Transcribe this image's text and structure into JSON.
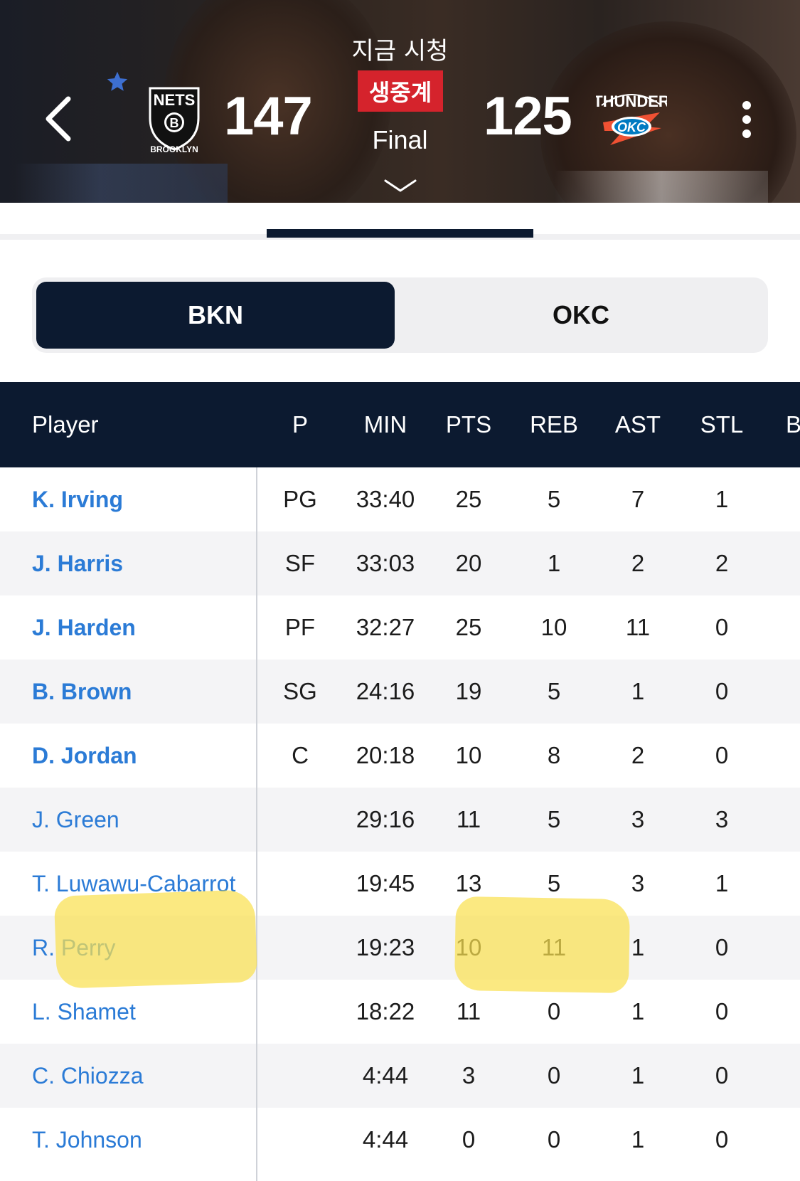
{
  "header": {
    "watch_label": "지금 시청",
    "live_badge": "생중계",
    "status": "Final",
    "home": {
      "abbr": "BKN",
      "score": "147",
      "logo_lines": [
        "NETS",
        "B",
        "BROOKLYN"
      ]
    },
    "away": {
      "abbr": "OKC",
      "score": "125",
      "logo_lines": [
        "THUNDER",
        "OKC"
      ]
    },
    "favorite_color": "#3d6fd1"
  },
  "team_toggle": {
    "options": [
      "BKN",
      "OKC"
    ],
    "selected": "BKN"
  },
  "table": {
    "columns": [
      "Player",
      "P",
      "MIN",
      "PTS",
      "REB",
      "AST",
      "STL",
      "B"
    ],
    "rows": [
      {
        "name": "K. Irving",
        "pos": "PG",
        "min": "33:40",
        "pts": "25",
        "reb": "5",
        "ast": "7",
        "stl": "1"
      },
      {
        "name": "J. Harris",
        "pos": "SF",
        "min": "33:03",
        "pts": "20",
        "reb": "1",
        "ast": "2",
        "stl": "2"
      },
      {
        "name": "J. Harden",
        "pos": "PF",
        "min": "32:27",
        "pts": "25",
        "reb": "10",
        "ast": "11",
        "stl": "0"
      },
      {
        "name": "B. Brown",
        "pos": "SG",
        "min": "24:16",
        "pts": "19",
        "reb": "5",
        "ast": "1",
        "stl": "0"
      },
      {
        "name": "D. Jordan",
        "pos": "C",
        "min": "20:18",
        "pts": "10",
        "reb": "8",
        "ast": "2",
        "stl": "0"
      },
      {
        "name": "J. Green",
        "pos": "",
        "min": "29:16",
        "pts": "11",
        "reb": "5",
        "ast": "3",
        "stl": "3"
      },
      {
        "name": "T. Luwawu-Cabarrot",
        "pos": "",
        "min": "19:45",
        "pts": "13",
        "reb": "5",
        "ast": "3",
        "stl": "1"
      },
      {
        "name": "R. Perry",
        "pos": "",
        "min": "19:23",
        "pts": "10",
        "reb": "11",
        "ast": "1",
        "stl": "0"
      },
      {
        "name": "L. Shamet",
        "pos": "",
        "min": "18:22",
        "pts": "11",
        "reb": "0",
        "ast": "1",
        "stl": "0"
      },
      {
        "name": "C. Chiozza",
        "pos": "",
        "min": "4:44",
        "pts": "3",
        "reb": "0",
        "ast": "1",
        "stl": "0"
      },
      {
        "name": "T. Johnson",
        "pos": "",
        "min": "4:44",
        "pts": "0",
        "reb": "0",
        "ast": "1",
        "stl": "0"
      }
    ]
  },
  "colors": {
    "navy": "#0c1a30",
    "live_red": "#d5232c",
    "player_link": "#2b7bd6",
    "highlighter": "#fae050"
  }
}
